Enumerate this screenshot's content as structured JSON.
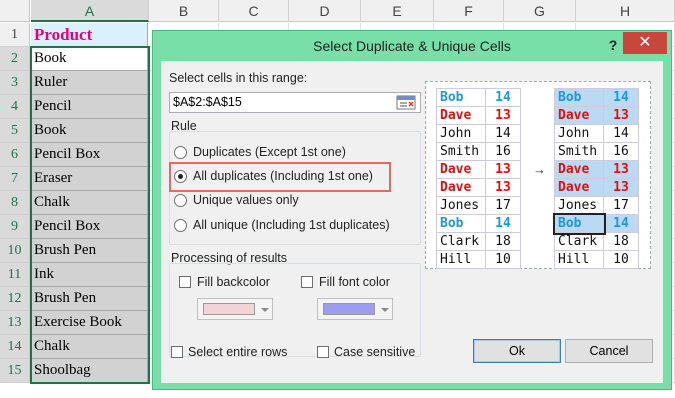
{
  "sheet": {
    "columns": [
      "A",
      "B",
      "C",
      "D",
      "E",
      "F",
      "G",
      "H"
    ],
    "rows": [
      "1",
      "2",
      "3",
      "4",
      "5",
      "6",
      "7",
      "8",
      "9",
      "10",
      "11",
      "12",
      "13",
      "14",
      "15"
    ],
    "column_a": [
      "Product",
      "Book",
      "Ruler",
      "Pencil",
      "Book",
      "Pencil Box",
      "Eraser",
      "Chalk",
      "Pencil Box",
      "Brush Pen",
      "Ink",
      "Brush Pen",
      "Exercise Book",
      "Chalk",
      "Shoolbag"
    ]
  },
  "dialog": {
    "title": "Select Duplicate & Unique Cells",
    "help_label": "?",
    "close_label": "✕",
    "range_label": "Select cells in this range:",
    "range_value": "$A$2:$A$15",
    "rule_label": "Rule",
    "rules": [
      "Duplicates (Except 1st one)",
      "All duplicates (Including 1st one)",
      "Unique values only",
      "All unique (Including 1st duplicates)"
    ],
    "selected_rule": "All duplicates (Including 1st one)",
    "processing_label": "Processing of results",
    "fill_backcolor_label": "Fill backcolor",
    "fill_backcolor_checked": false,
    "fill_font_color_label": "Fill font color",
    "fill_font_color_checked": false,
    "backcolor_swatch": "#f4d3d8",
    "font_color_swatch": "#9c9cf0",
    "select_entire_rows_label": "Select entire rows",
    "case_sensitive_label": "Case sensitive",
    "ok_label": "Ok",
    "cancel_label": "Cancel"
  },
  "preview": {
    "arrow": "→",
    "rows": [
      {
        "name": "Bob",
        "value": "14",
        "style": "blue",
        "highlighted": true
      },
      {
        "name": "Dave",
        "value": "13",
        "style": "red",
        "highlighted": true
      },
      {
        "name": "John",
        "value": "14",
        "style": "black",
        "highlighted": false
      },
      {
        "name": "Smith",
        "value": "16",
        "style": "black",
        "highlighted": false
      },
      {
        "name": "Dave",
        "value": "13",
        "style": "red",
        "highlighted": true
      },
      {
        "name": "Dave",
        "value": "13",
        "style": "red",
        "highlighted": true
      },
      {
        "name": "Jones",
        "value": "17",
        "style": "black",
        "highlighted": false
      },
      {
        "name": "Bob",
        "value": "14",
        "style": "blue",
        "highlighted": true
      },
      {
        "name": "Clark",
        "value": "18",
        "style": "black",
        "highlighted": false
      },
      {
        "name": "Hill",
        "value": "10",
        "style": "black",
        "highlighted": false
      }
    ]
  },
  "colors": {
    "dialog_frame": "#79dfa9",
    "close_button": "#c9463d",
    "header_text": "#e8007a",
    "header_fill": "#d9f1fb",
    "highlight_border": "#e46961"
  }
}
